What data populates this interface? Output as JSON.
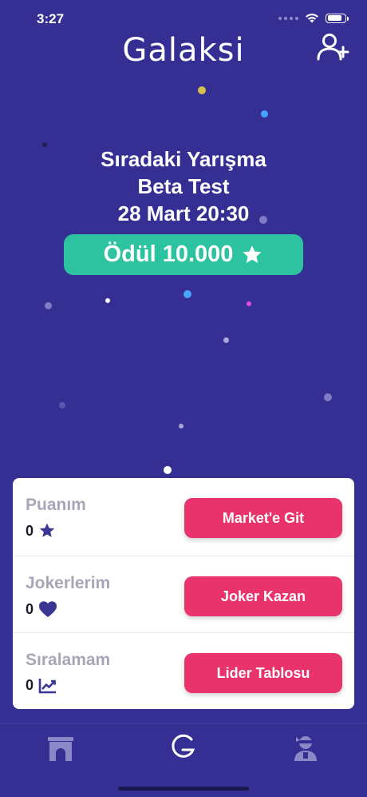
{
  "status_bar": {
    "time": "3:27",
    "battery_level": 0.85
  },
  "header": {
    "logo_text": "Galaksi",
    "add_user_icon": "add-user-icon"
  },
  "next_contest": {
    "heading": "Sıradaki Yarışma",
    "name": "Beta Test",
    "datetime": "28 Mart 20:30",
    "prize_label": "Ödül 10.000",
    "prize_icon": "star-icon"
  },
  "stats": [
    {
      "label": "Puanım",
      "value": "0",
      "icon": "star-icon",
      "button": "Market'e Git"
    },
    {
      "label": "Jokerlerim",
      "value": "0",
      "icon": "heart-icon",
      "button": "Joker Kazan"
    },
    {
      "label": "Sıralamam",
      "value": "0",
      "icon": "trending-chart-icon",
      "button": "Lider Tablosu"
    }
  ],
  "tab_bar": {
    "tabs": [
      {
        "name": "arena",
        "icon": "arch-icon",
        "active": false
      },
      {
        "name": "home",
        "icon": "galaksi-g-icon",
        "active": true
      },
      {
        "name": "profile",
        "icon": "ninja-avatar-icon",
        "active": false
      }
    ]
  },
  "colors": {
    "background": "#352f94",
    "accent_green": "#2dc3a0",
    "accent_pink": "#e9336d",
    "icon_purple": "#3b3694"
  }
}
